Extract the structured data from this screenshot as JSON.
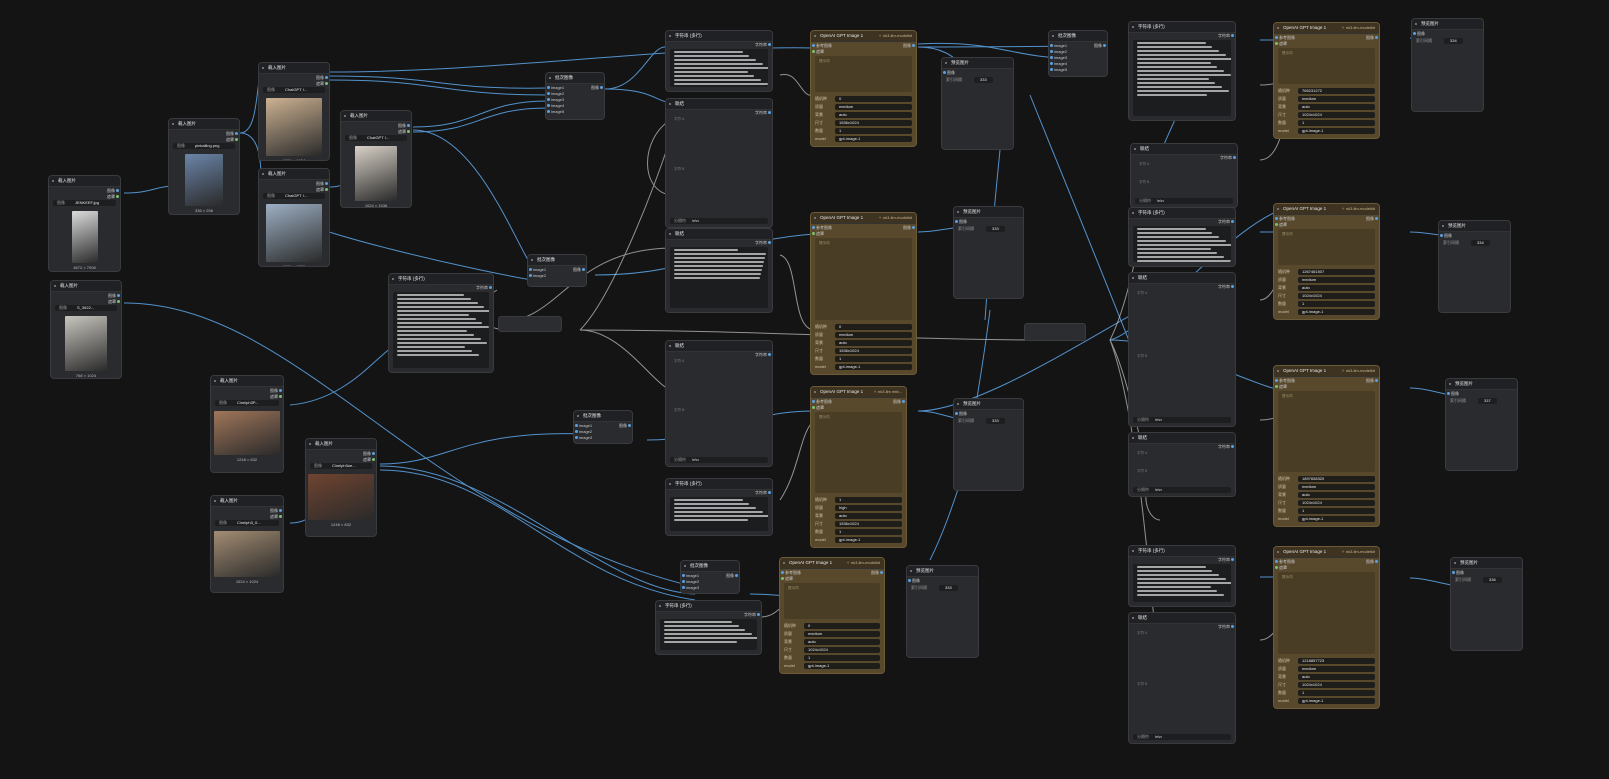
{
  "colors": {
    "background": "#141414",
    "node": "#2a2b2e",
    "gen_node": "#58482c",
    "link_image": "#5aa0e0",
    "link_other": "#bdbdbd"
  },
  "labels": {
    "load_image": "载入图片",
    "image_port": "图像",
    "mask_port": "遮罩",
    "batch_image": "批次图像",
    "string_multiline": "字符串 (多行)",
    "string_port": "字符串",
    "compare": "联结",
    "delimiter": "分隔符",
    "delimiter_value": "\\n\\n",
    "preview": "预览图片",
    "preview_sub": "索引间隔",
    "image1": "image1",
    "image2": "image2",
    "image3": "image3",
    "image4": "image4",
    "image5": "image5",
    "gen_title": "OpenAI GPT Image 1",
    "gen_badge": "✧ nk3-llm-modelkit",
    "gen_badge2": "✧ nk3-llm mtb...",
    "gen_image_in": "参考图像",
    "gen_mask_in": "遮罩",
    "gen_out": "图像",
    "prompt_ph": "提示词",
    "seed": "随机种",
    "quality": "质量",
    "background": "背景",
    "size": "尺寸",
    "n": "数量",
    "model": "model",
    "model_value": "gpt-image-1",
    "medium": "medium",
    "high": "high",
    "auto": "auto",
    "size1": "1024x1024",
    "size2": "1536x1024",
    "size3": "1024x1536",
    "ph_a": "字符 A",
    "ph_b": "字符 B"
  },
  "load_nodes": [
    {
      "file": "JENKEEF.jpg",
      "size": "4672 × 7008"
    },
    {
      "file": "pinkalling.png",
      "size": "336 × 256"
    },
    {
      "file": "ChatGPT I...",
      "size": "1024 × 1024"
    },
    {
      "file": "ChatGPT I...",
      "size": "1024 × 1536"
    },
    {
      "file": "ChatGPT I...",
      "size": "1024 × 1536"
    },
    {
      "file": "S_3622...",
      "size": "768 × 1024"
    },
    {
      "file": "Cinelph3P...",
      "size": "1248 × 832"
    },
    {
      "file": "Cinelph3_0...",
      "size": "1024 × 1024"
    },
    {
      "file": "Cinelph3oe...",
      "size": "1248 × 832"
    }
  ],
  "gen_nodes": [
    {
      "seed": "0",
      "quality": "medium",
      "background": "auto",
      "size": "1536x1024",
      "n": "1"
    },
    {
      "seed": "0",
      "quality": "medium",
      "background": "auto",
      "size": "1536x1024",
      "n": "1"
    },
    {
      "seed": "1",
      "quality": "high",
      "background": "auto",
      "size": "1536x1024",
      "n": "1"
    },
    {
      "seed": "0",
      "quality": "medium",
      "background": "auto",
      "size": "1024x1024",
      "n": "1"
    },
    {
      "seed": "765231272",
      "quality": "medium",
      "background": "auto",
      "size": "1024x1024",
      "n": "1"
    },
    {
      "seed": "1267461507",
      "quality": "medium",
      "background": "auto",
      "size": "1024x1024",
      "n": "1"
    },
    {
      "seed": "1897658320",
      "quality": "medium",
      "background": "auto",
      "size": "1024x1024",
      "n": "1"
    },
    {
      "seed": "1218857723",
      "quality": "medium",
      "background": "auto",
      "size": "1024x1024",
      "n": "1"
    }
  ],
  "preview_values": [
    "333",
    "333",
    "333",
    "333",
    "334",
    "334",
    "337",
    "336"
  ]
}
